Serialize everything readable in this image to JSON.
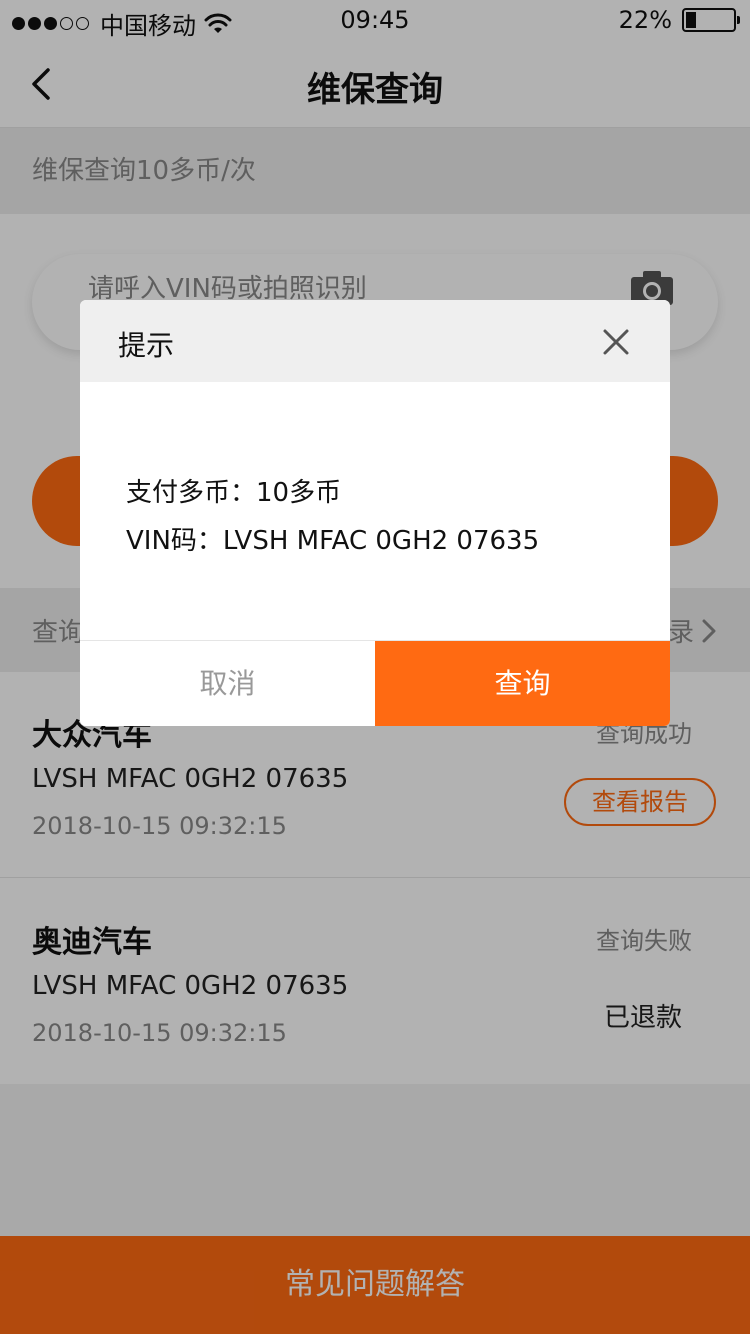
{
  "status_bar": {
    "carrier": "中国移动",
    "time": "09:45",
    "battery": "22%"
  },
  "nav": {
    "title": "维保查询"
  },
  "banner": {
    "price_text": "维保查询10多币/次"
  },
  "search": {
    "placeholder": "请呼入VIN码或拍照识别"
  },
  "records": {
    "header_label": "查询",
    "more_label": "录",
    "items": [
      {
        "title": "大众汽车",
        "vin": "LVSH MFAC 0GH2 07635",
        "time": "2018-10-15  09:32:15",
        "status": "查询成功",
        "action": "查看报告"
      },
      {
        "title": "奥迪汽车",
        "vin": "LVSH MFAC 0GH2 07635",
        "time": "2018-10-15  09:32:15",
        "status": "查询失败",
        "action": "已退款"
      }
    ]
  },
  "footer": {
    "label": "常见问题解答"
  },
  "dialog": {
    "title": "提示",
    "lines": [
      "支付多币：10多币",
      "VIN码：LVSH MFAC 0GH2 07635"
    ],
    "cancel_label": "取消",
    "confirm_label": "查询"
  },
  "colors": {
    "accent": "#ff6a12",
    "overlay": "rgba(0,0,0,0.3)"
  }
}
